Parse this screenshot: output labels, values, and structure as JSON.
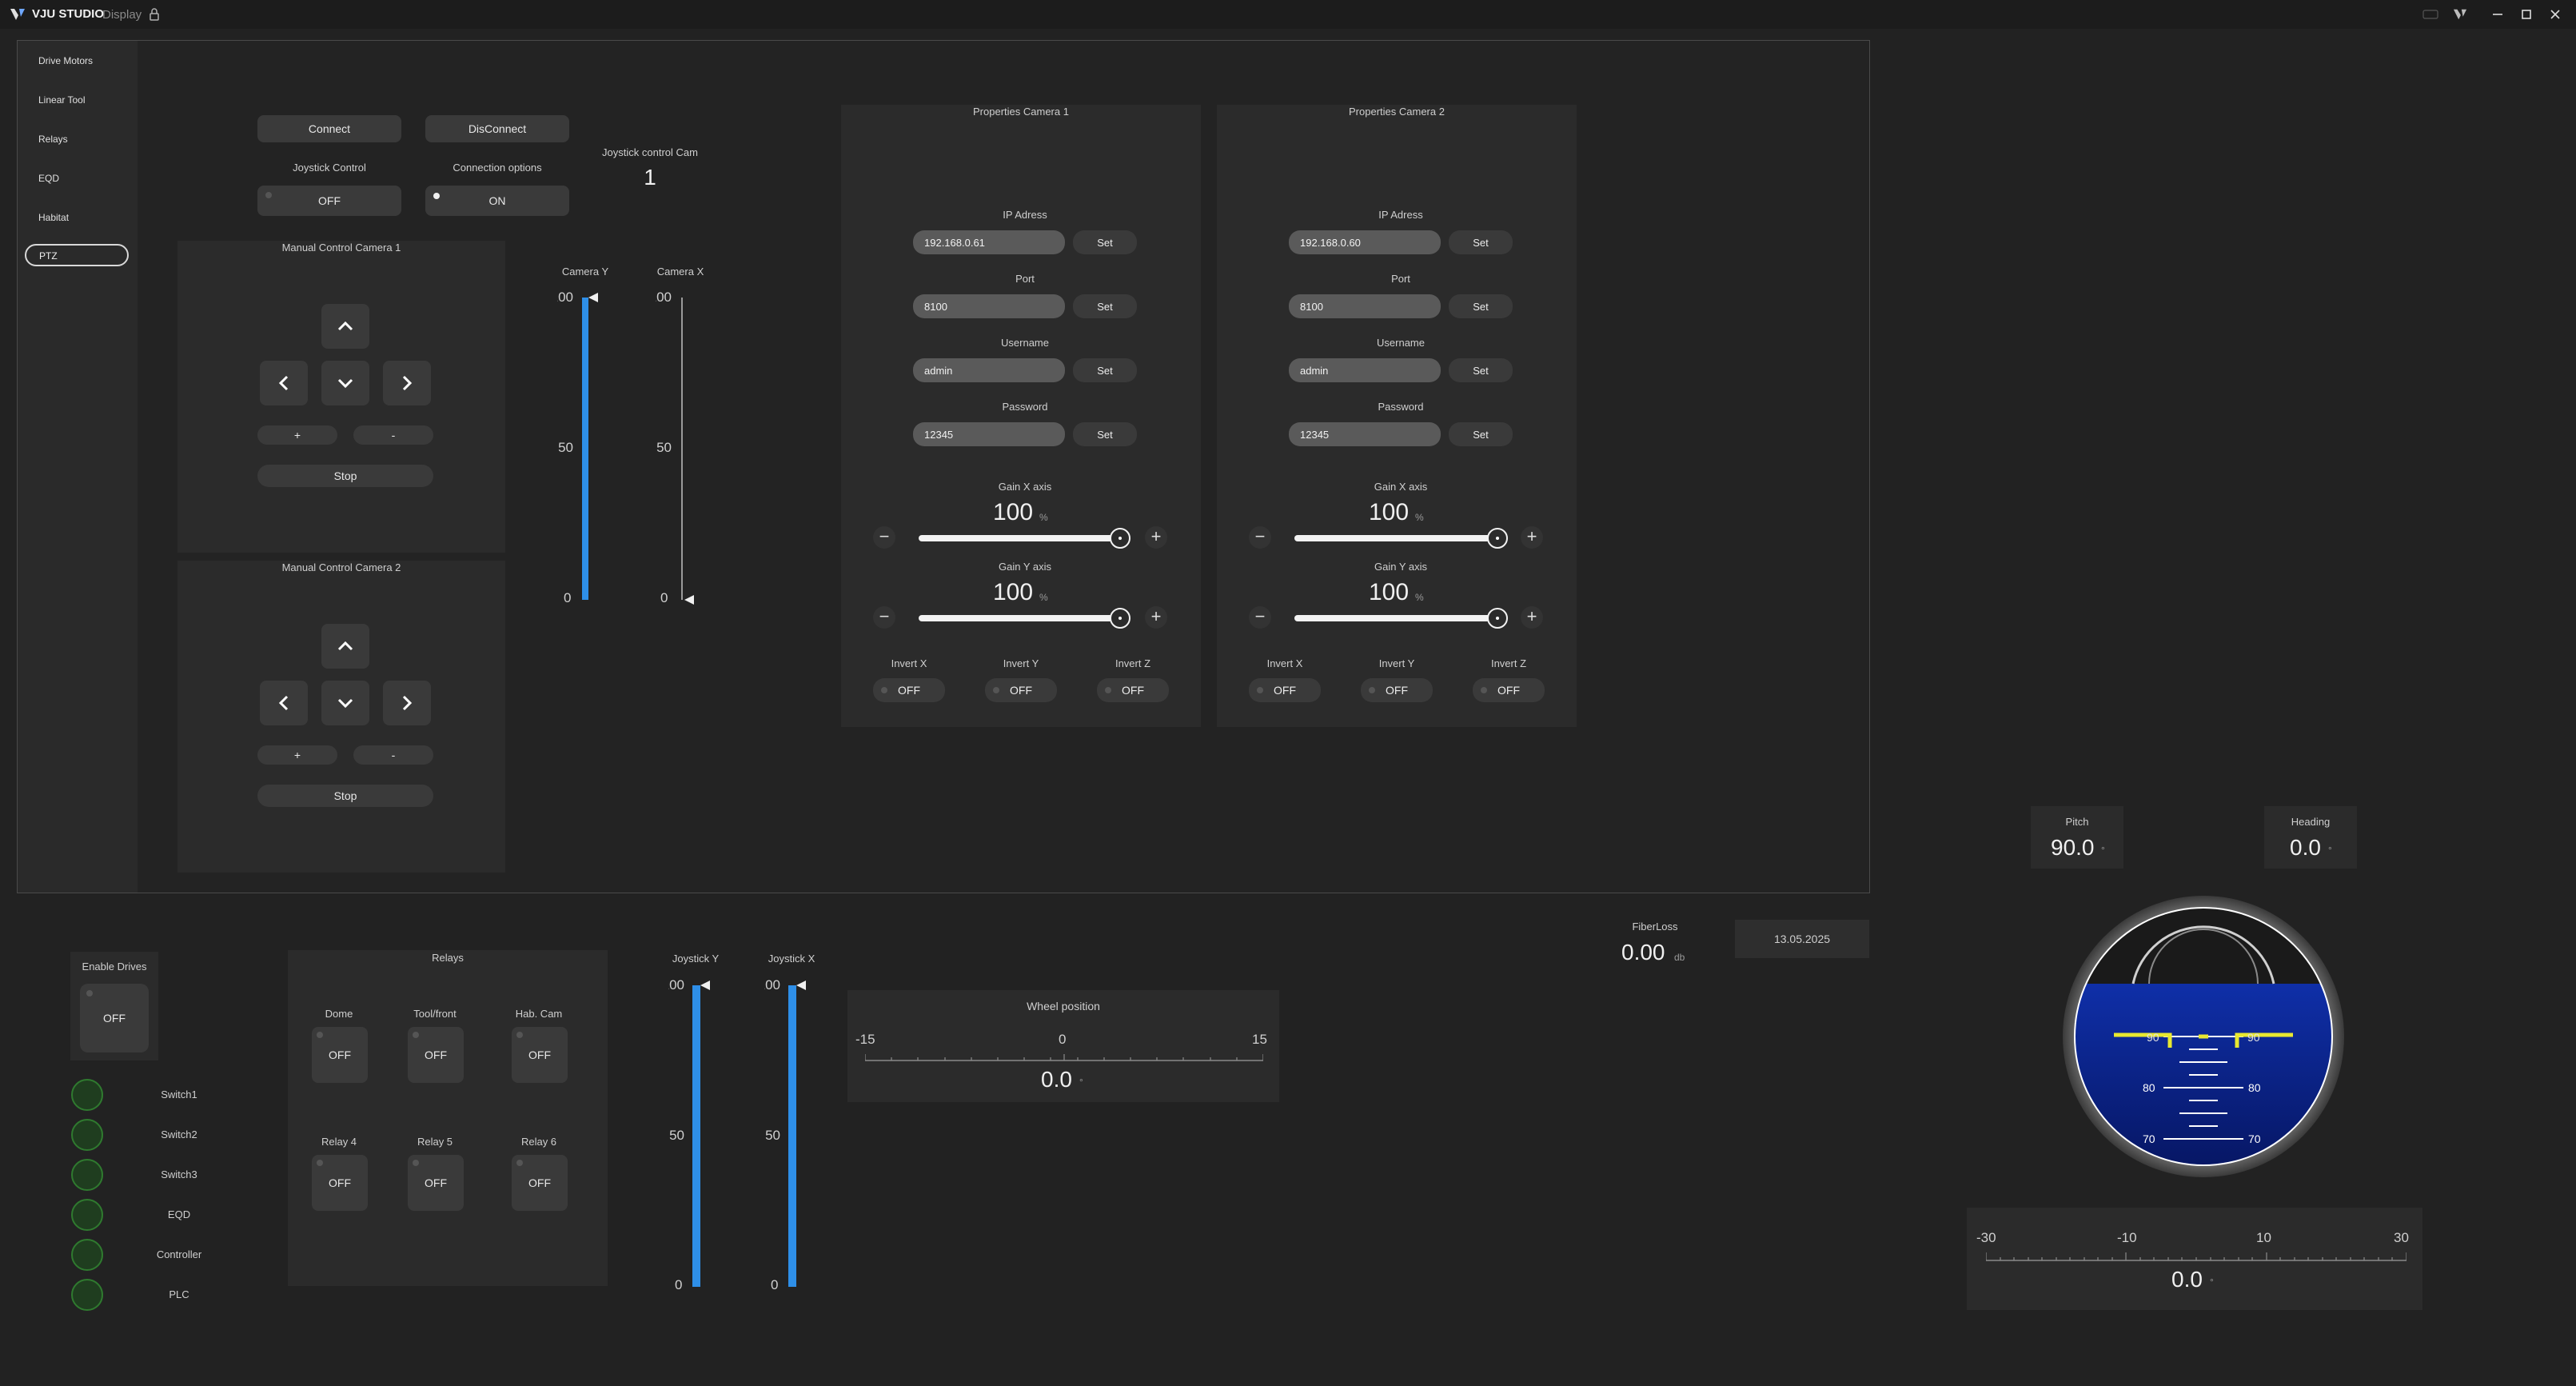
{
  "titlebar": {
    "brand": "VJU STUDIO",
    "app": "Display"
  },
  "sidebar": {
    "items": [
      {
        "label": "Drive Motors"
      },
      {
        "label": "Linear Tool"
      },
      {
        "label": "Relays"
      },
      {
        "label": "EQD"
      },
      {
        "label": "Habitat"
      },
      {
        "label": "PTZ",
        "selected": true
      }
    ]
  },
  "ptz": {
    "connect_label": "Connect",
    "disconnect_label": "DisConnect",
    "joystick_control_label": "Joystick Control",
    "joystick_control_value": "OFF",
    "connection_options_label": "Connection options",
    "connection_options_value": "ON",
    "joystick_cam_label": "Joystick control Cam",
    "joystick_cam_value": "1",
    "manual1": {
      "title": "Manual Control Camera 1",
      "plus": "+",
      "minus": "-",
      "stop": "Stop"
    },
    "manual2": {
      "title": "Manual Control Camera 2",
      "plus": "+",
      "minus": "-",
      "stop": "Stop"
    },
    "camera_y": {
      "label": "Camera Y",
      "max": "100",
      "mid": "50",
      "min": "0",
      "value": 100
    },
    "camera_x": {
      "label": "Camera X",
      "max": "100",
      "mid": "50",
      "min": "0",
      "value": 0
    }
  },
  "cam1": {
    "title": "Properties Camera 1",
    "ip_label": "IP Adress",
    "ip": "192.168.0.61",
    "port_label": "Port",
    "port": "8100",
    "username_label": "Username",
    "username": "admin",
    "password_label": "Password",
    "password": "12345",
    "set": "Set",
    "gain_x_label": "Gain X axis",
    "gain_x": "100",
    "gain_y_label": "Gain Y axis",
    "gain_y": "100",
    "unit": "%",
    "invert_x_label": "Invert X",
    "invert_y_label": "Invert Y",
    "invert_z_label": "Invert Z",
    "invert_x": "OFF",
    "invert_y": "OFF",
    "invert_z": "OFF"
  },
  "cam2": {
    "title": "Properties Camera 2",
    "ip_label": "IP Adress",
    "ip": "192.168.0.60",
    "port_label": "Port",
    "port": "8100",
    "username_label": "Username",
    "username": "admin",
    "password_label": "Password",
    "password": "12345",
    "set": "Set",
    "gain_x_label": "Gain X axis",
    "gain_x": "100",
    "gain_y_label": "Gain Y axis",
    "gain_y": "100",
    "unit": "%",
    "invert_x_label": "Invert X",
    "invert_y_label": "Invert Y",
    "invert_z_label": "Invert Z",
    "invert_x": "OFF",
    "invert_y": "OFF",
    "invert_z": "OFF"
  },
  "bottom": {
    "enable_drives_label": "Enable Drives",
    "enable_drives_value": "OFF",
    "switches": [
      "Switch1",
      "Switch2",
      "Switch3",
      "EQD",
      "Controller",
      "PLC"
    ],
    "relays_title": "Relays",
    "relays": [
      {
        "label": "Dome",
        "value": "OFF"
      },
      {
        "label": "Tool/front",
        "value": "OFF"
      },
      {
        "label": "Hab. Cam",
        "value": "OFF"
      },
      {
        "label": "Relay 4",
        "value": "OFF"
      },
      {
        "label": "Relay 5",
        "value": "OFF"
      },
      {
        "label": "Relay 6",
        "value": "OFF"
      }
    ],
    "joystick_y": {
      "label": "Joystick Y",
      "max": "100",
      "mid": "50",
      "min": "0",
      "value": 100
    },
    "joystick_x": {
      "label": "Joystick X",
      "max": "100",
      "mid": "50",
      "min": "0",
      "value": 100
    },
    "wheel": {
      "title": "Wheel position",
      "min": "-15",
      "mid": "0",
      "max": "15",
      "value": "0.0",
      "unit": "°"
    },
    "fiberloss": {
      "label": "FiberLoss",
      "value": "0.00",
      "unit": "db"
    },
    "date": "13.05.2025",
    "pitch": {
      "label": "Pitch",
      "value": "90.0",
      "unit": "°"
    },
    "heading": {
      "label": "Heading",
      "value": "0.0",
      "unit": "°"
    },
    "horizon_ticks": [
      "90",
      "80",
      "70"
    ],
    "roll": {
      "t1": "-30",
      "t2": "-10",
      "t3": "10",
      "t4": "30",
      "value": "0.0",
      "unit": "°"
    }
  },
  "colors": {
    "accent": "#2e8fe8",
    "status_ok": "#2f7a2f",
    "horizon_yellow": "#e8e830"
  }
}
